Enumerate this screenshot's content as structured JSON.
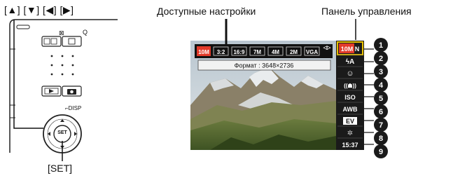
{
  "callouts": {
    "arrow_keys": "[▲] [▼] [◀] [▶]",
    "set_key": "[SET]",
    "available_settings": "Доступные настройки",
    "control_panel": "Панель управления"
  },
  "camera": {
    "top_icon": "⊠",
    "zoom_icon": "Q",
    "disp_label": "⌐DISP",
    "set_button": "SET"
  },
  "screen": {
    "size_options": [
      "10M",
      "3:2",
      "16:9",
      "7M",
      "4M",
      "2M",
      "VGA"
    ],
    "scroll_indicator": "◁▷",
    "format_label": "Формат : 3648×2736"
  },
  "panel": {
    "items": [
      {
        "id": "image-size",
        "label": "10M N",
        "number": "1"
      },
      {
        "id": "flash",
        "label": "ϟA",
        "number": "2"
      },
      {
        "id": "face-detection",
        "label": "☺",
        "number": "3"
      },
      {
        "id": "anti-shake",
        "label": "((☗))",
        "number": "4"
      },
      {
        "id": "iso",
        "label": "ISO",
        "number": "5"
      },
      {
        "id": "white-balance",
        "label": "AWB",
        "number": "6"
      },
      {
        "id": "ev-shift",
        "label": "EV",
        "number": "7"
      },
      {
        "id": "lighting",
        "label": "✲",
        "number": "8"
      },
      {
        "id": "date-time",
        "label": "15:37",
        "number": "9"
      }
    ]
  }
}
